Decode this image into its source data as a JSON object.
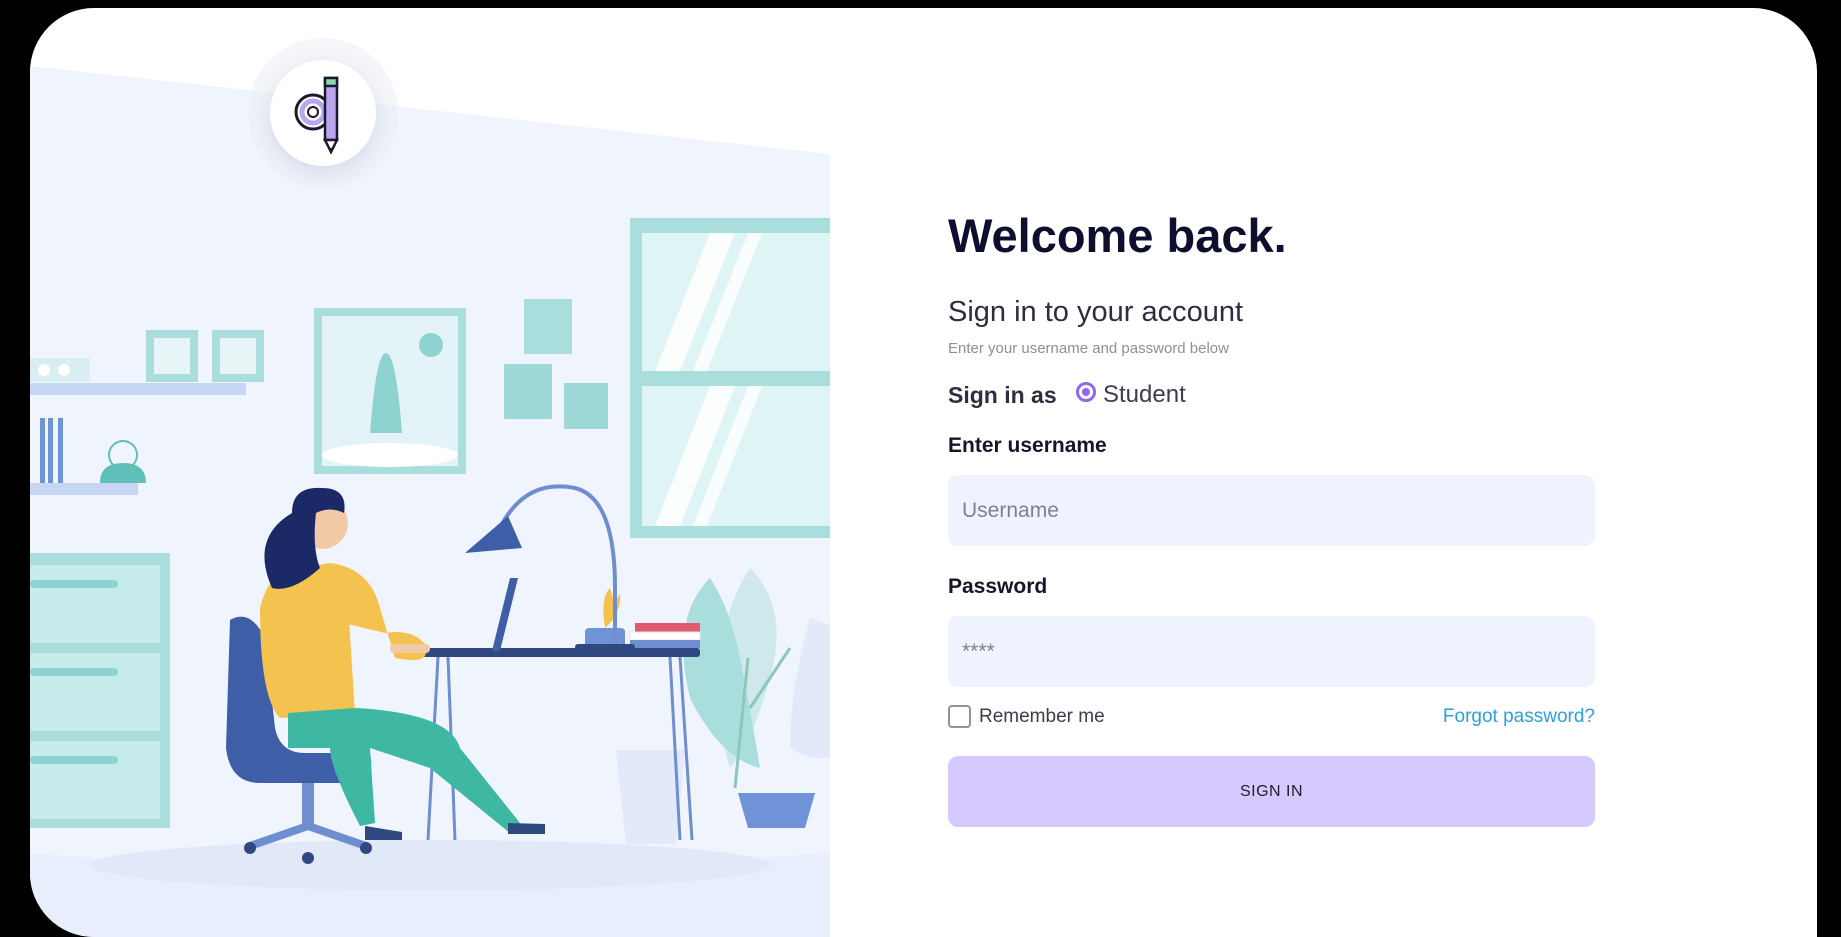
{
  "brand": {
    "logo_icon": "pencil-letter-q-logo-icon"
  },
  "illustration": {
    "description_icon": "woman-working-at-desk-illustration"
  },
  "login": {
    "title": "Welcome back.",
    "subtitle": "Sign in to your account",
    "hint": "Enter your username and password below",
    "role_label": "Sign in as",
    "role_option": "Student",
    "role_selected": true,
    "username_label": "Enter username",
    "username_placeholder": "Username",
    "username_value": "",
    "password_label": "Password",
    "password_placeholder": "****",
    "password_value": "",
    "remember_label": "Remember me",
    "remember_checked": false,
    "forgot_label": "Forgot password?",
    "submit_label": "SIGN IN"
  },
  "colors": {
    "accent": "#8f67f0",
    "button_bg": "#d6c9fd",
    "input_bg": "#eff3fd",
    "link": "#2d9fe0",
    "heading": "#0e0f2e"
  }
}
